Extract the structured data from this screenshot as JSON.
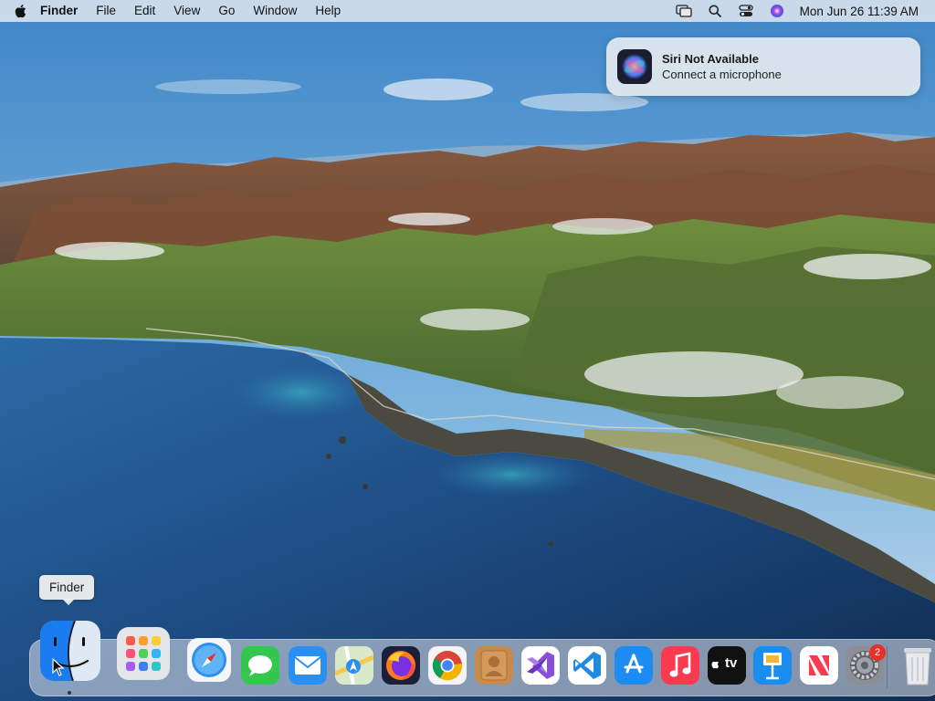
{
  "menubar": {
    "apple_icon": "apple-logo-icon",
    "app_name": "Finder",
    "items": [
      "File",
      "Edit",
      "View",
      "Go",
      "Window",
      "Help"
    ],
    "status_icons": [
      "screen-mirroring-icon",
      "search-icon",
      "control-center-icon",
      "siri-icon"
    ],
    "clock": "Mon Jun 26  11:39 AM"
  },
  "notification": {
    "icon": "siri-icon",
    "title": "Siri Not Available",
    "body": "Connect a microphone"
  },
  "dock": {
    "tooltip": "Finder",
    "apps": [
      {
        "name": "Finder",
        "icon": "finder-icon",
        "running": true
      },
      {
        "name": "Launchpad",
        "icon": "launchpad-icon",
        "running": false
      },
      {
        "name": "Safari",
        "icon": "safari-icon",
        "running": false
      },
      {
        "name": "Messages",
        "icon": "messages-icon",
        "running": false
      },
      {
        "name": "Mail",
        "icon": "mail-icon",
        "running": false
      },
      {
        "name": "Maps",
        "icon": "maps-icon",
        "running": false
      },
      {
        "name": "Firefox",
        "icon": "firefox-icon",
        "running": false
      },
      {
        "name": "Google Chrome",
        "icon": "chrome-icon",
        "running": false
      },
      {
        "name": "Contacts",
        "icon": "contacts-icon",
        "running": false
      },
      {
        "name": "Visual Studio",
        "icon": "visual-studio-icon",
        "running": false
      },
      {
        "name": "Visual Studio Code",
        "icon": "vscode-icon",
        "running": false
      },
      {
        "name": "App Store",
        "icon": "app-store-icon",
        "running": false
      },
      {
        "name": "Music",
        "icon": "music-icon",
        "running": false
      },
      {
        "name": "TV",
        "icon": "apple-tv-icon",
        "running": false,
        "label": "tv"
      },
      {
        "name": "Keynote",
        "icon": "keynote-icon",
        "running": false
      },
      {
        "name": "News",
        "icon": "news-icon",
        "running": false
      },
      {
        "name": "System Preferences",
        "icon": "system-preferences-icon",
        "running": false,
        "badge": "2"
      },
      {
        "name": "Trash",
        "icon": "trash-icon",
        "running": false
      }
    ]
  },
  "colors": {
    "badge": "#e8302a",
    "menubar": "#e8ecf2",
    "ocean": "#1f4f86",
    "sky": "#5b9bd0"
  }
}
